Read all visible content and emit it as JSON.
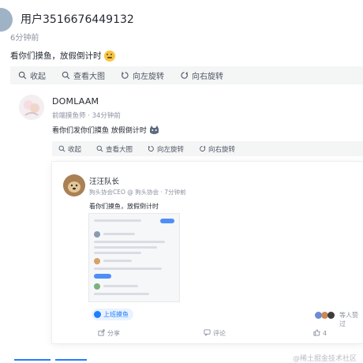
{
  "outer_post": {
    "username": "用户3516676449132",
    "time": "6分钟前",
    "content": "看你们摸鱼，放假倒计时",
    "toolbar": {
      "collapse": "收起",
      "view_large": "查看大图",
      "rotate_left": "向左旋转",
      "rotate_right": "向右旋转"
    }
  },
  "reply_post": {
    "username": "DOMLAAM",
    "meta": "前端摸鱼师 · 34分钟前",
    "content": "看你们发你们摸鱼 放假倒计时",
    "toolbar": {
      "collapse": "收起",
      "view_large": "查看大图",
      "rotate_left": "向左旋转",
      "rotate_right": "向右旋转"
    }
  },
  "inner_card": {
    "username": "汪汪队长",
    "meta": "狗头协会CEO @ 狗头协会 · 7分钟前",
    "content": "看你们摸鱼，放假倒计时",
    "topic_tag": "上班摸鱼",
    "actions": {
      "share": "分享",
      "comment": "评论",
      "like_count": "4",
      "likers_text": "等人赞过"
    }
  },
  "watermark": "@稀土掘金技术社区",
  "colors": {
    "accent": "#1e80ff",
    "toolbar_bg": "#f4f5f5",
    "text_muted": "#8a919f"
  },
  "icons": [
    "search-icon",
    "rotate-left-icon",
    "rotate-right-icon",
    "share-icon",
    "comment-icon",
    "like-icon"
  ]
}
